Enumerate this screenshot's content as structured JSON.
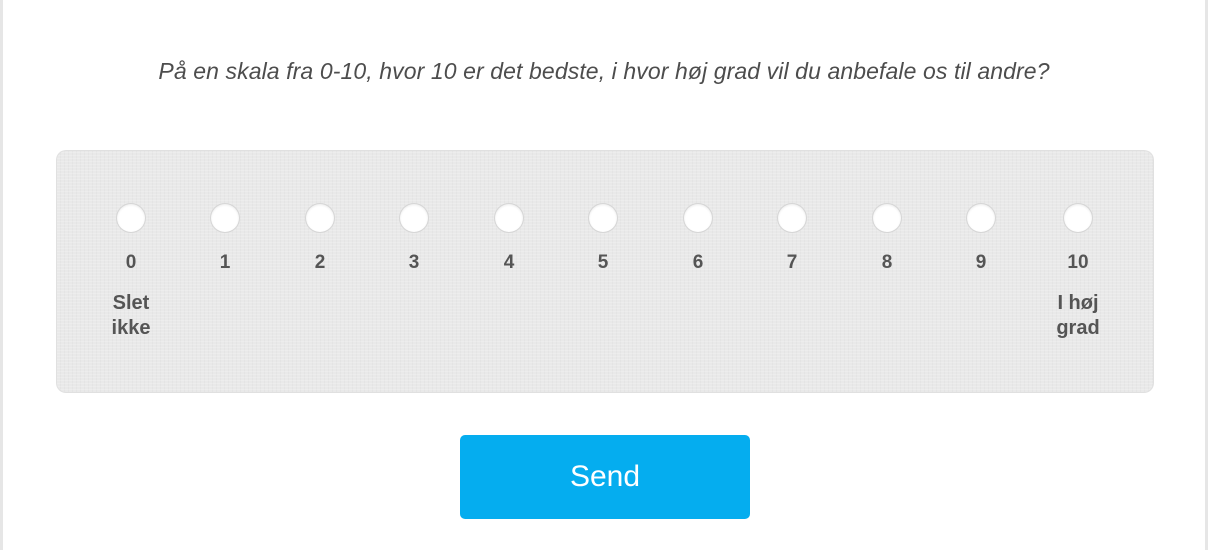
{
  "question": "På en skala fra 0-10, hvor 10 er det bedste, i hvor høj grad vil du anbefale os til andre?",
  "scale": {
    "options": [
      "0",
      "1",
      "2",
      "3",
      "4",
      "5",
      "6",
      "7",
      "8",
      "9",
      "10"
    ],
    "selected": null,
    "low_anchor": [
      "Slet",
      "ikke"
    ],
    "high_anchor": [
      "I høj",
      "grad"
    ]
  },
  "colors": {
    "button_bg": "#05adef",
    "button_text": "#ffffff",
    "panel_bg": "#e9e9e9",
    "text": "#555555"
  },
  "send_label": "Send"
}
